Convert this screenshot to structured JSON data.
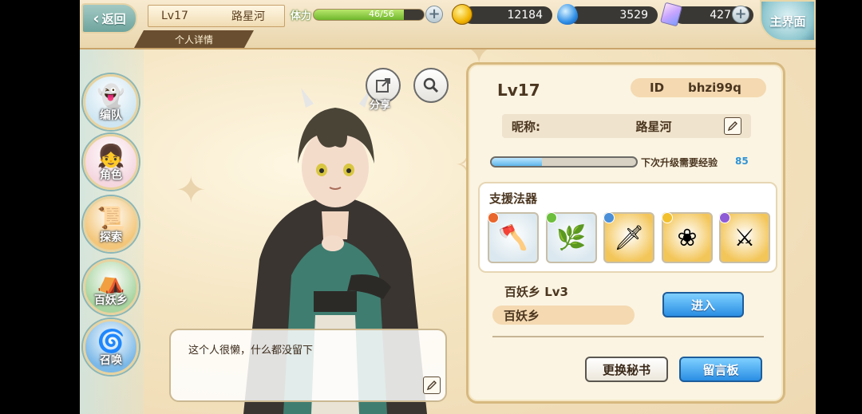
{
  "top_bar": {
    "back_label": "返回",
    "level": "Lv17",
    "player_name": "路星河",
    "detail_tab": "个人详情",
    "stamina_label": "体力",
    "stamina_value": "46/56",
    "stamina_fraction": 0.82,
    "gold": "12184",
    "gems": "3529",
    "crystals": "427",
    "home_label": "主界面"
  },
  "side_menu": {
    "items": [
      {
        "label": "编队",
        "icon": "team-icon",
        "color": "#cfe6f2"
      },
      {
        "label": "角色",
        "icon": "character-icon",
        "color": "#f5d7e0"
      },
      {
        "label": "探索",
        "icon": "explore-icon",
        "color": "#f3c67a"
      },
      {
        "label": "百妖乡",
        "icon": "village-icon",
        "color": "#a7d4a0"
      },
      {
        "label": "召唤",
        "icon": "summon-icon",
        "color": "#7ab8e8"
      }
    ]
  },
  "actions": {
    "share_label": "分享",
    "search_icon": "magnifier-icon"
  },
  "message": {
    "text": "这个人很懒，什么都没留下"
  },
  "profile": {
    "level": "Lv17",
    "id_label": "ID",
    "id_value": "bhzi99q",
    "nickname_label": "昵称:",
    "nickname_value": "路星河",
    "exp_label": "下次升级需要经验",
    "exp_value": "85",
    "exp_fraction": 0.35,
    "support_title": "支援法器",
    "artifacts": [
      {
        "icon": "axe-icon",
        "bg": "#dbe8ef",
        "dot": "#e8652b"
      },
      {
        "icon": "leaf-icon",
        "bg": "#dbe8ef",
        "dot": "#6cbf3c"
      },
      {
        "icon": "sword-icon",
        "bg": "#f3c65a",
        "dot": "#4a8fd8"
      },
      {
        "icon": "wreath-icon",
        "bg": "#f3c65a",
        "dot": "#f2c02c"
      },
      {
        "icon": "blade-icon",
        "bg": "#f3c65a",
        "dot": "#8e5bd6"
      }
    ],
    "village_line": "百妖乡  Lv3",
    "village_name": "百妖乡",
    "enter_label": "进入",
    "change_secretary_label": "更换秘书",
    "message_board_label": "留言板"
  }
}
